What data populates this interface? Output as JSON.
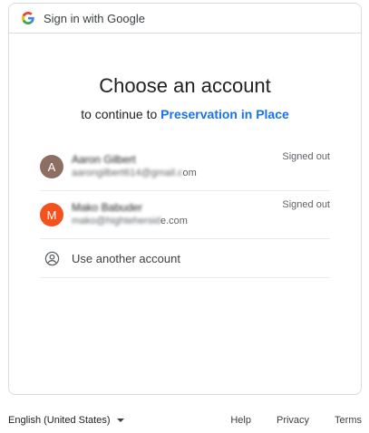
{
  "header": {
    "title": "Sign in with Google"
  },
  "main": {
    "heading": "Choose an account",
    "subheading_prefix": "to continue to",
    "app_name": "Preservation in Place"
  },
  "accounts": [
    {
      "initial": "A",
      "avatar_color": "#8d6e63",
      "name": "Aaron Gilbert",
      "email_hidden": "aarongilbert614@gmail.c",
      "email_visible": "om",
      "status": "Signed out"
    },
    {
      "initial": "M",
      "avatar_color": "#f4511e",
      "name": "Mako Babuder",
      "email_hidden": "mako@hightehersid",
      "email_visible": "e.com",
      "status": "Signed out"
    }
  ],
  "another_account": {
    "label": "Use another account",
    "icon": "account-circle-icon"
  },
  "footer": {
    "language": "English (United States)",
    "help": "Help",
    "privacy": "Privacy",
    "terms": "Terms"
  }
}
